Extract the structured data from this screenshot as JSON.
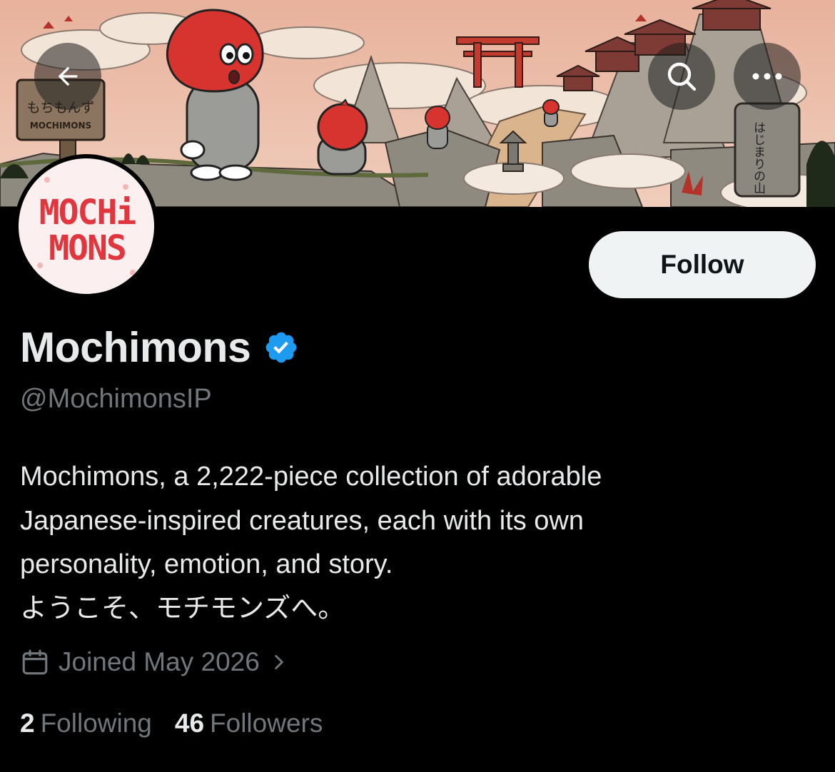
{
  "banner": {
    "sign_jp": "もちもんず",
    "sign_en": "MOCHIMONS",
    "stone_jp": "はじまりの山"
  },
  "nav": {
    "back_icon": "arrow-left-icon",
    "search_icon": "search-icon",
    "more_icon": "more-horizontal-icon"
  },
  "avatar": {
    "logo_line1": "MOCHi",
    "logo_line2": "MONS",
    "logo_color": "#e2363f"
  },
  "actions": {
    "follow_label": "Follow"
  },
  "profile": {
    "display_name": "Mochimons",
    "verified_color": "#1d9bf0",
    "handle": "@MochimonsIP",
    "bio_lines": [
      "Mochimons, a 2,222-piece collection of adorable",
      "Japanese-inspired creatures, each with its own",
      "personality, emotion, and story.",
      "ようこそ、モチモンズへ。"
    ],
    "joined": "Joined May 2026"
  },
  "stats": {
    "following_count": "2",
    "following_label": "Following",
    "followers_count": "46",
    "followers_label": "Followers"
  },
  "colors": {
    "background": "#000000",
    "text_primary": "#e7e9ea",
    "text_secondary": "#71767b",
    "button_bg": "#eff3f4"
  }
}
